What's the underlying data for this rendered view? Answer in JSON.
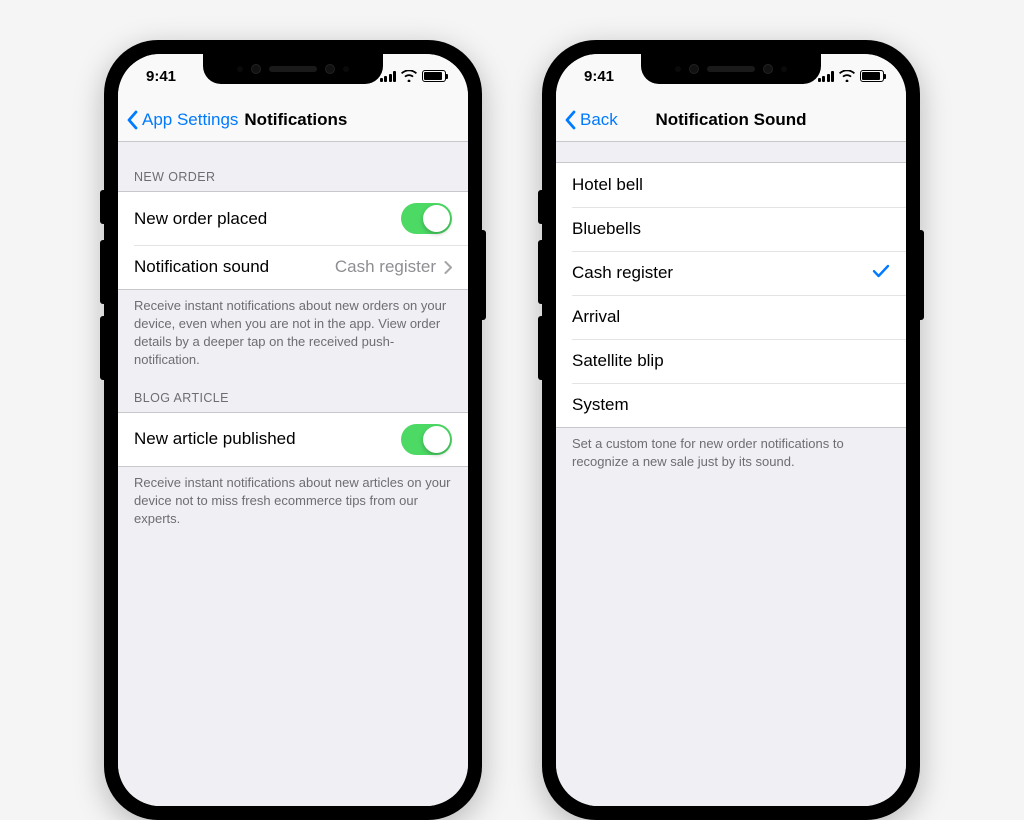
{
  "status": {
    "time": "9:41"
  },
  "left": {
    "nav": {
      "back": "App Settings",
      "title": "Notifications"
    },
    "sections": {
      "new_order": {
        "header": "NEW ORDER",
        "toggle_row": {
          "label": "New order placed",
          "on": true
        },
        "sound_row": {
          "label": "Notification sound",
          "value": "Cash register"
        },
        "footer": "Receive instant notifications about new orders on your device, even when you are not in the app. View order details by a deeper tap on the received push-notification."
      },
      "blog": {
        "header": "BLOG ARTICLE",
        "toggle_row": {
          "label": "New article published",
          "on": true
        },
        "footer": "Receive instant notifications about new articles on your device not to miss fresh ecommerce tips from our experts."
      }
    }
  },
  "right": {
    "nav": {
      "back": "Back",
      "title": "Notification Sound"
    },
    "options": [
      {
        "label": "Hotel bell",
        "selected": false
      },
      {
        "label": "Bluebells",
        "selected": false
      },
      {
        "label": "Cash register",
        "selected": true
      },
      {
        "label": "Arrival",
        "selected": false
      },
      {
        "label": "Satellite blip",
        "selected": false
      },
      {
        "label": "System",
        "selected": false
      }
    ],
    "footer": "Set a custom tone for new order notifications to recognize a new sale just by its sound."
  }
}
